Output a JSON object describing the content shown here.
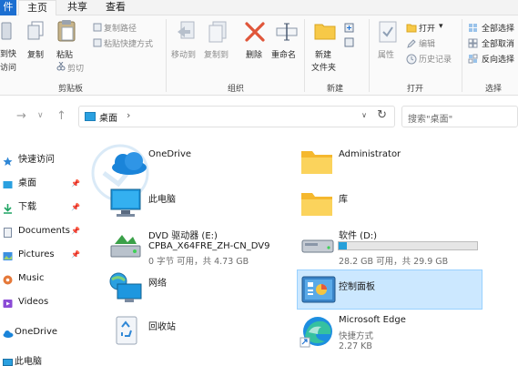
{
  "tabs": {
    "file": "件",
    "home": "主页",
    "share": "共享",
    "view": "查看"
  },
  "ribbon": {
    "clipboard": {
      "pin_label": "到快",
      "pin_label2": "访问",
      "copy": "复制",
      "paste": "粘贴",
      "copy_path": "复制路径",
      "paste_shortcut": "粘贴快捷方式",
      "cut": "剪切",
      "group": "剪贴板"
    },
    "organize": {
      "move_to": "移动到",
      "copy_to": "复制到",
      "delete": "删除",
      "rename": "重命名",
      "group": "组织"
    },
    "new": {
      "new_folder": "新建",
      "new_folder2": "文件夹",
      "group": "新建"
    },
    "open": {
      "properties": "属性",
      "open": "打开",
      "edit": "编辑",
      "history": "历史记录",
      "group": "打开"
    },
    "select": {
      "select_all": "全部选择",
      "select_none": "全部取消",
      "invert": "反向选择",
      "group": "选择"
    }
  },
  "nav": {
    "breadcrumb": "桌面",
    "search_placeholder": "搜索\"桌面\""
  },
  "sidebar": {
    "items": [
      {
        "label": "快速访问",
        "icon": "star-icon"
      },
      {
        "label": "桌面",
        "icon": "desktop-icon",
        "pinned": true
      },
      {
        "label": "下载",
        "icon": "download-icon",
        "pinned": true
      },
      {
        "label": "Documents",
        "icon": "documents-icon",
        "pinned": true
      },
      {
        "label": "Pictures",
        "icon": "pictures-icon",
        "pinned": true
      },
      {
        "label": "Music",
        "icon": "music-icon"
      },
      {
        "label": "Videos",
        "icon": "videos-icon"
      },
      {
        "label": "OneDrive",
        "icon": "onedrive-icon"
      },
      {
        "label": "此电脑",
        "icon": "pc-icon"
      }
    ]
  },
  "items": [
    {
      "name": "OneDrive",
      "icon": "onedrive-icon"
    },
    {
      "name": "Administrator",
      "icon": "folder-icon"
    },
    {
      "name": "此电脑",
      "icon": "pc-icon"
    },
    {
      "name": "库",
      "icon": "folder-icon"
    },
    {
      "name": "DVD 驱动器 (E:)",
      "line2": "CPBA_X64FRE_ZH-CN_DV9",
      "line3": "0 字节 可用，共 4.73 GB",
      "icon": "dvd-drive-icon"
    },
    {
      "name": "软件 (D:)",
      "line2": "28.2 GB 可用，共 29.9 GB",
      "icon": "drive-icon",
      "used_fraction": 0.057
    },
    {
      "name": "网络",
      "icon": "network-icon"
    },
    {
      "name": "控制面板",
      "icon": "control-panel-icon",
      "selected": true
    },
    {
      "name": "回收站",
      "icon": "recycle-bin-icon"
    },
    {
      "name": "Microsoft Edge",
      "line2": "快捷方式",
      "line3": "2.27 KB",
      "icon": "edge-icon"
    }
  ],
  "colors": {
    "accent": "#1c6fd1",
    "selection": "#cce8ff",
    "folder": "#f7c948",
    "drive_bar": "#26a0da"
  }
}
